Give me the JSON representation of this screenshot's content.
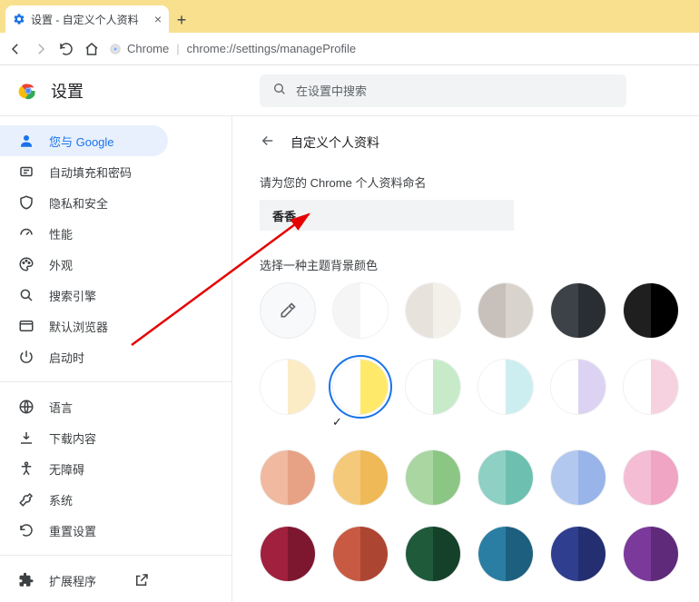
{
  "browser": {
    "tab_title": "设置 - 自定义个人资料",
    "chrome_label": "Chrome",
    "url": "chrome://settings/manageProfile"
  },
  "app": {
    "title": "设置",
    "search_placeholder": "在设置中搜索"
  },
  "sidebar": {
    "items": [
      {
        "label": "您与 Google",
        "icon": "person-icon",
        "active": true
      },
      {
        "label": "自动填充和密码",
        "icon": "autofill-icon"
      },
      {
        "label": "隐私和安全",
        "icon": "shield-icon"
      },
      {
        "label": "性能",
        "icon": "speed-icon"
      },
      {
        "label": "外观",
        "icon": "palette-icon"
      },
      {
        "label": "搜索引擎",
        "icon": "search-icon"
      },
      {
        "label": "默认浏览器",
        "icon": "browser-icon"
      },
      {
        "label": "启动时",
        "icon": "power-icon"
      }
    ],
    "items2": [
      {
        "label": "语言",
        "icon": "globe-icon"
      },
      {
        "label": "下载内容",
        "icon": "download-icon"
      },
      {
        "label": "无障碍",
        "icon": "accessibility-icon"
      },
      {
        "label": "系统",
        "icon": "wrench-icon"
      },
      {
        "label": "重置设置",
        "icon": "reset-icon"
      }
    ],
    "items3": [
      {
        "label": "扩展程序",
        "icon": "extension-icon",
        "external": true
      }
    ]
  },
  "content": {
    "header": "自定义个人资料",
    "name_label": "请为您的 Chrome 个人资料命名",
    "name_value": "香香",
    "theme_label": "选择一种主题背景颜色",
    "selected_index": 7,
    "swatches": [
      {
        "type": "picker"
      },
      {
        "l": "#f5f5f5",
        "r": "#ffffff"
      },
      {
        "l": "#e8e2dd",
        "r": "#f3efe9"
      },
      {
        "l": "#c8c1bb",
        "r": "#d9d3cd"
      },
      {
        "l": "#3c4247",
        "r": "#2a2e32"
      },
      {
        "l": "#1f1f1f",
        "r": "#000000"
      },
      {
        "l": "#ffffff",
        "r": "#fcecc5"
      },
      {
        "l": "#ffffff",
        "r": "#ffe96b"
      },
      {
        "l": "#ffffff",
        "r": "#c7eac9"
      },
      {
        "l": "#ffffff",
        "r": "#cdeef1"
      },
      {
        "l": "#ffffff",
        "r": "#dcd3f3"
      },
      {
        "l": "#ffffff",
        "r": "#f6d2e0"
      },
      {
        "l": "#f0b9a0",
        "r": "#e7a285"
      },
      {
        "l": "#f5c97a",
        "r": "#efb957"
      },
      {
        "l": "#a9d6a1",
        "r": "#8cc685"
      },
      {
        "l": "#8ed0c3",
        "r": "#6dc0b0"
      },
      {
        "l": "#b3c8ef",
        "r": "#98b4e8"
      },
      {
        "l": "#f4bdd3",
        "r": "#efa5c3"
      },
      {
        "l": "#a0203e",
        "r": "#7d1730"
      },
      {
        "l": "#c85a44",
        "r": "#ac4531"
      },
      {
        "l": "#1f5a3b",
        "r": "#15402a"
      },
      {
        "l": "#2a7ea3",
        "r": "#1d5f7e"
      },
      {
        "l": "#2f3e8f",
        "r": "#232f70"
      },
      {
        "l": "#7a399b",
        "r": "#5e2a79"
      }
    ]
  }
}
